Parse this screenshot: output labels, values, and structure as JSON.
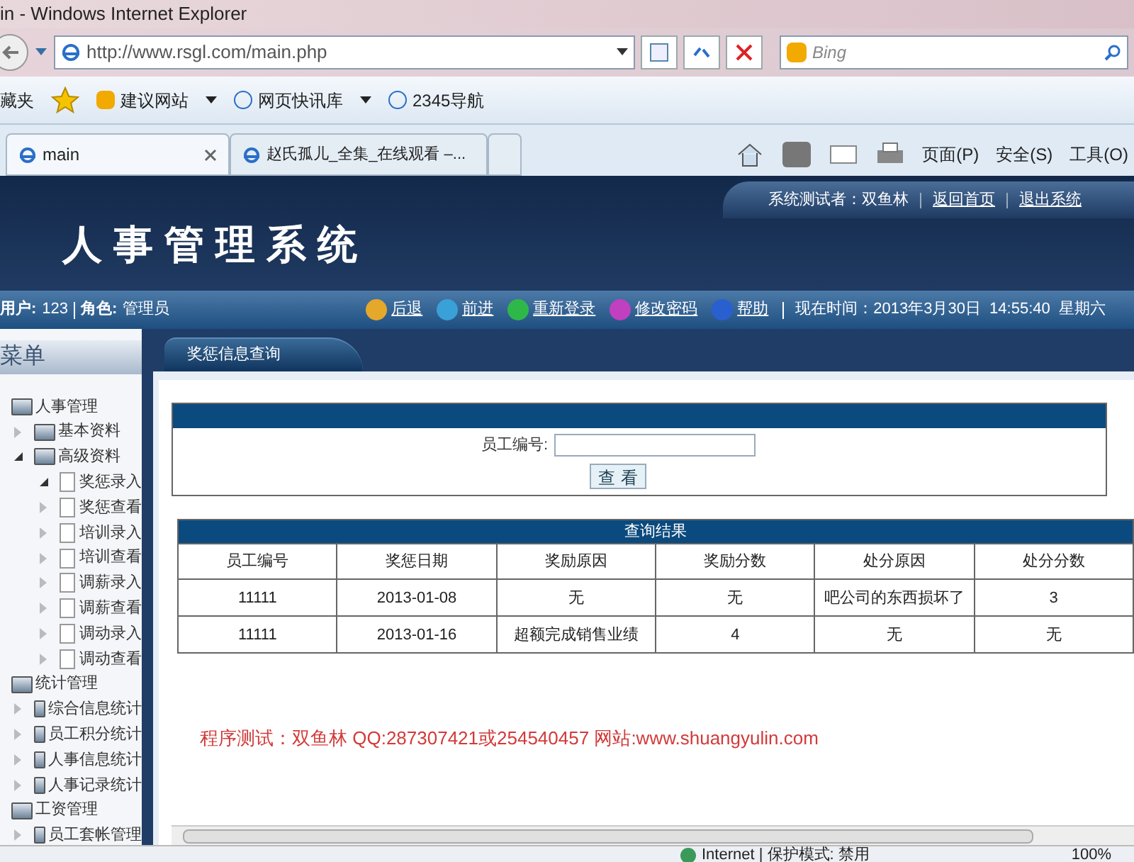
{
  "browser": {
    "title": "in - Windows Internet Explorer",
    "address": "http://www.rsgl.com/main.php",
    "search_placeholder": "Bing",
    "favorites_label": "藏夹",
    "favorites": [
      {
        "label": "建议网站",
        "dropdown": true
      },
      {
        "label": "网页快讯库",
        "dropdown": true
      },
      {
        "label": "2345导航",
        "dropdown": false
      }
    ],
    "tabs": [
      {
        "label": "main",
        "selected": true
      },
      {
        "label": "赵氏孤儿_全集_在线观看 –...",
        "selected": false
      }
    ],
    "commands": [
      "页面(P)",
      "安全(S)",
      "工具(O)"
    ]
  },
  "header": {
    "title": "人事管理系统",
    "tester": "系统测试者：双鱼林",
    "links": [
      "返回首页",
      "退出系统"
    ]
  },
  "info_bar": {
    "user_label": "用户:",
    "user": "123",
    "role_label": "角色:",
    "role": "管理员",
    "actions": [
      {
        "label": "后退",
        "kind": "back"
      },
      {
        "label": "前进",
        "kind": "forward"
      },
      {
        "label": "重新登录",
        "kind": "login"
      },
      {
        "label": "修改密码",
        "kind": "lock"
      },
      {
        "label": "帮助",
        "kind": "help"
      }
    ],
    "time": "现在时间：2013年3月30日  14:55:40  星期六"
  },
  "sidebar": {
    "title": "菜单",
    "items": [
      {
        "label": "人事管理",
        "kind": "folder",
        "children": [
          {
            "label": "基本资料",
            "kind": "folder",
            "expanded": false
          },
          {
            "label": "高级资料",
            "kind": "folder",
            "expanded": true,
            "children": [
              {
                "label": "奖惩录入",
                "kind": "page",
                "expanded": true
              },
              {
                "label": "奖惩查看",
                "kind": "page",
                "expanded": false
              },
              {
                "label": "培训录入",
                "kind": "page",
                "expanded": false
              },
              {
                "label": "培训查看",
                "kind": "page",
                "expanded": false
              },
              {
                "label": "调薪录入",
                "kind": "page",
                "expanded": false
              },
              {
                "label": "调薪查看",
                "kind": "page",
                "expanded": false
              },
              {
                "label": "调动录入",
                "kind": "page",
                "expanded": false
              },
              {
                "label": "调动查看",
                "kind": "page",
                "expanded": false
              }
            ]
          }
        ]
      },
      {
        "label": "统计管理",
        "kind": "folder",
        "children": [
          {
            "label": "综合信息统计",
            "kind": "folder",
            "expanded": false
          },
          {
            "label": "员工积分统计",
            "kind": "folder",
            "expanded": false
          },
          {
            "label": "人事信息统计",
            "kind": "folder",
            "expanded": false
          },
          {
            "label": "人事记录统计",
            "kind": "folder",
            "expanded": false
          }
        ]
      },
      {
        "label": "工资管理",
        "kind": "folder",
        "children": [
          {
            "label": "员工套帐管理",
            "kind": "folder",
            "expanded": false
          }
        ]
      }
    ]
  },
  "content_tab": "奖惩信息查询",
  "search_form": {
    "label": "员工编号:",
    "button": "查 看"
  },
  "results": {
    "title": "查询结果",
    "columns": [
      "员工编号",
      "奖惩日期",
      "奖励原因",
      "奖励分数",
      "处分原因",
      "处分分数"
    ],
    "rows": [
      [
        "11111",
        "2013-01-08",
        "无",
        "无",
        "吧公司的东西损坏了",
        "3"
      ],
      [
        "11111",
        "2013-01-16",
        "超额完成销售业绩",
        "4",
        "无",
        "无"
      ]
    ]
  },
  "footer_note": "程序测试：双鱼林 QQ:287307421或254540457 网站:www.shuangyulin.com",
  "status_bar": {
    "zone": "Internet | 保护模式: 禁用",
    "zoom": "100%"
  }
}
